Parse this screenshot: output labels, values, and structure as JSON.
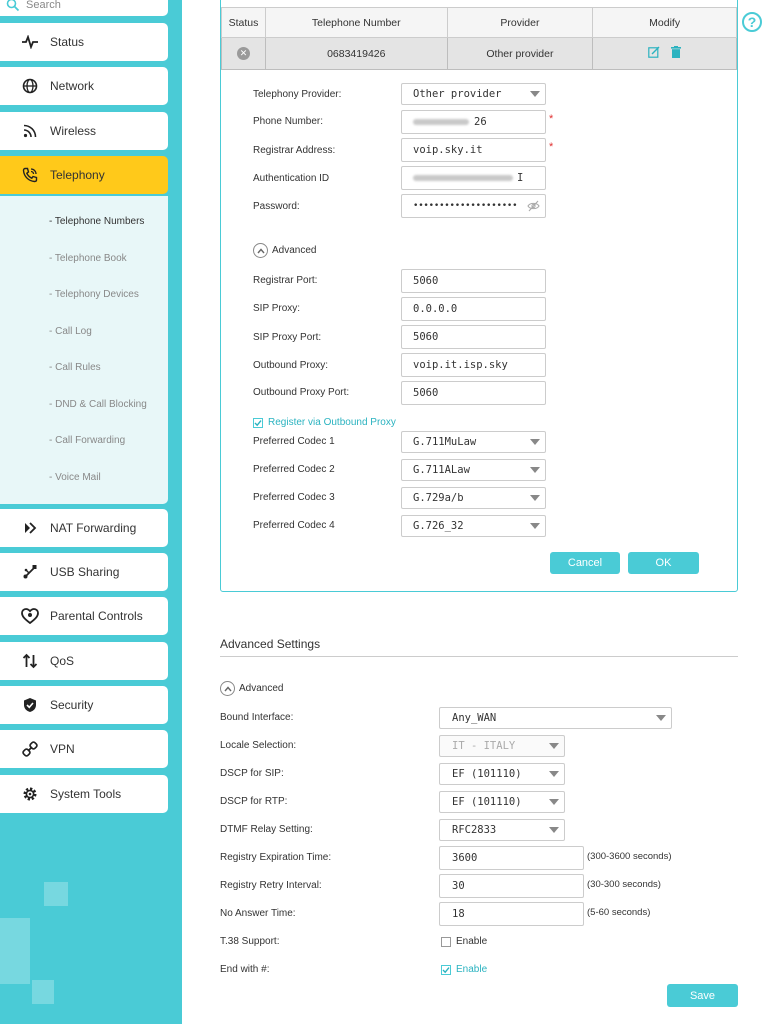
{
  "sidebar": {
    "search_placeholder": "Search",
    "items": [
      {
        "label": "Status",
        "icon": "pulse-icon"
      },
      {
        "label": "Network",
        "icon": "globe-icon"
      },
      {
        "label": "Wireless",
        "icon": "wifi-icon"
      },
      {
        "label": "Telephony",
        "icon": "phone-icon"
      },
      {
        "label": "NAT Forwarding",
        "icon": "nat-icon"
      },
      {
        "label": "USB Sharing",
        "icon": "usb-icon"
      },
      {
        "label": "Parental Controls",
        "icon": "heart-icon"
      },
      {
        "label": "QoS",
        "icon": "qos-icon"
      },
      {
        "label": "Security",
        "icon": "shield-icon"
      },
      {
        "label": "VPN",
        "icon": "vpn-icon"
      },
      {
        "label": "System Tools",
        "icon": "gear-icon"
      }
    ],
    "submenu": [
      "- Telephone Numbers",
      "- Telephone Book",
      "- Telephony Devices",
      "- Call Log",
      "- Call Rules",
      "- DND & Call Blocking",
      "- Call Forwarding",
      "- Voice Mail"
    ],
    "active_color": "#ffc91a",
    "accent": "#4acbd6"
  },
  "table": {
    "headers": [
      "Status",
      "Telephone Number",
      "Provider",
      "Modify"
    ],
    "rows": [
      {
        "status_icon": "disabled-circle-icon",
        "number": "0683419426",
        "provider": "Other provider"
      }
    ]
  },
  "form": {
    "telephony_provider_label": "Telephony Provider:",
    "telephony_provider_value": "Other provider",
    "phone_number_label": "Phone Number:",
    "phone_number_value": "26",
    "registrar_address_label": "Registrar Address:",
    "registrar_address_value": "voip.sky.it",
    "auth_id_label": "Authentication ID",
    "auth_id_value": "I",
    "password_label": "Password:",
    "password_value": "••••••••••••••••••••",
    "advanced_label": "Advanced",
    "registrar_port_label": "Registrar Port:",
    "registrar_port_value": "5060",
    "sip_proxy_label": "SIP Proxy:",
    "sip_proxy_value": "0.0.0.0",
    "sip_proxy_port_label": "SIP Proxy Port:",
    "sip_proxy_port_value": "5060",
    "outbound_proxy_label": "Outbound Proxy:",
    "outbound_proxy_value": "voip.it.isp.sky",
    "outbound_proxy_port_label": "Outbound Proxy Port:",
    "outbound_proxy_port_value": "5060",
    "register_via_outbound_label": "Register via Outbound Proxy",
    "codecs": [
      {
        "label": "Preferred Codec 1",
        "value": "G.711MuLaw"
      },
      {
        "label": "Preferred Codec 2",
        "value": "G.711ALaw"
      },
      {
        "label": "Preferred Codec 3",
        "value": "G.729a/b"
      },
      {
        "label": "Preferred Codec 4",
        "value": "G.726_32"
      }
    ],
    "cancel_label": "Cancel",
    "ok_label": "OK"
  },
  "advanced_settings": {
    "title": "Advanced Settings",
    "advanced_label": "Advanced",
    "bound_interface_label": "Bound Interface:",
    "bound_interface_value": "Any_WAN",
    "locale_label": "Locale Selection:",
    "locale_value": "IT - ITALY",
    "dscp_sip_label": "DSCP for SIP:",
    "dscp_sip_value": "EF (101110)",
    "dscp_rtp_label": "DSCP for RTP:",
    "dscp_rtp_value": "EF (101110)",
    "dtmf_label": "DTMF Relay Setting:",
    "dtmf_value": "RFC2833",
    "reg_exp_label": "Registry Expiration Time:",
    "reg_exp_value": "3600",
    "reg_exp_hint": "(300-3600 seconds)",
    "reg_retry_label": "Registry Retry Interval:",
    "reg_retry_value": "30",
    "reg_retry_hint": "(30-300 seconds)",
    "no_answer_label": "No Answer Time:",
    "no_answer_value": "18",
    "no_answer_hint": "(5-60 seconds)",
    "t38_label": "T.38 Support:",
    "t38_enable_label": "Enable",
    "end_hash_label": "End with #:",
    "end_hash_enable_label": "Enable",
    "save_label": "Save"
  }
}
